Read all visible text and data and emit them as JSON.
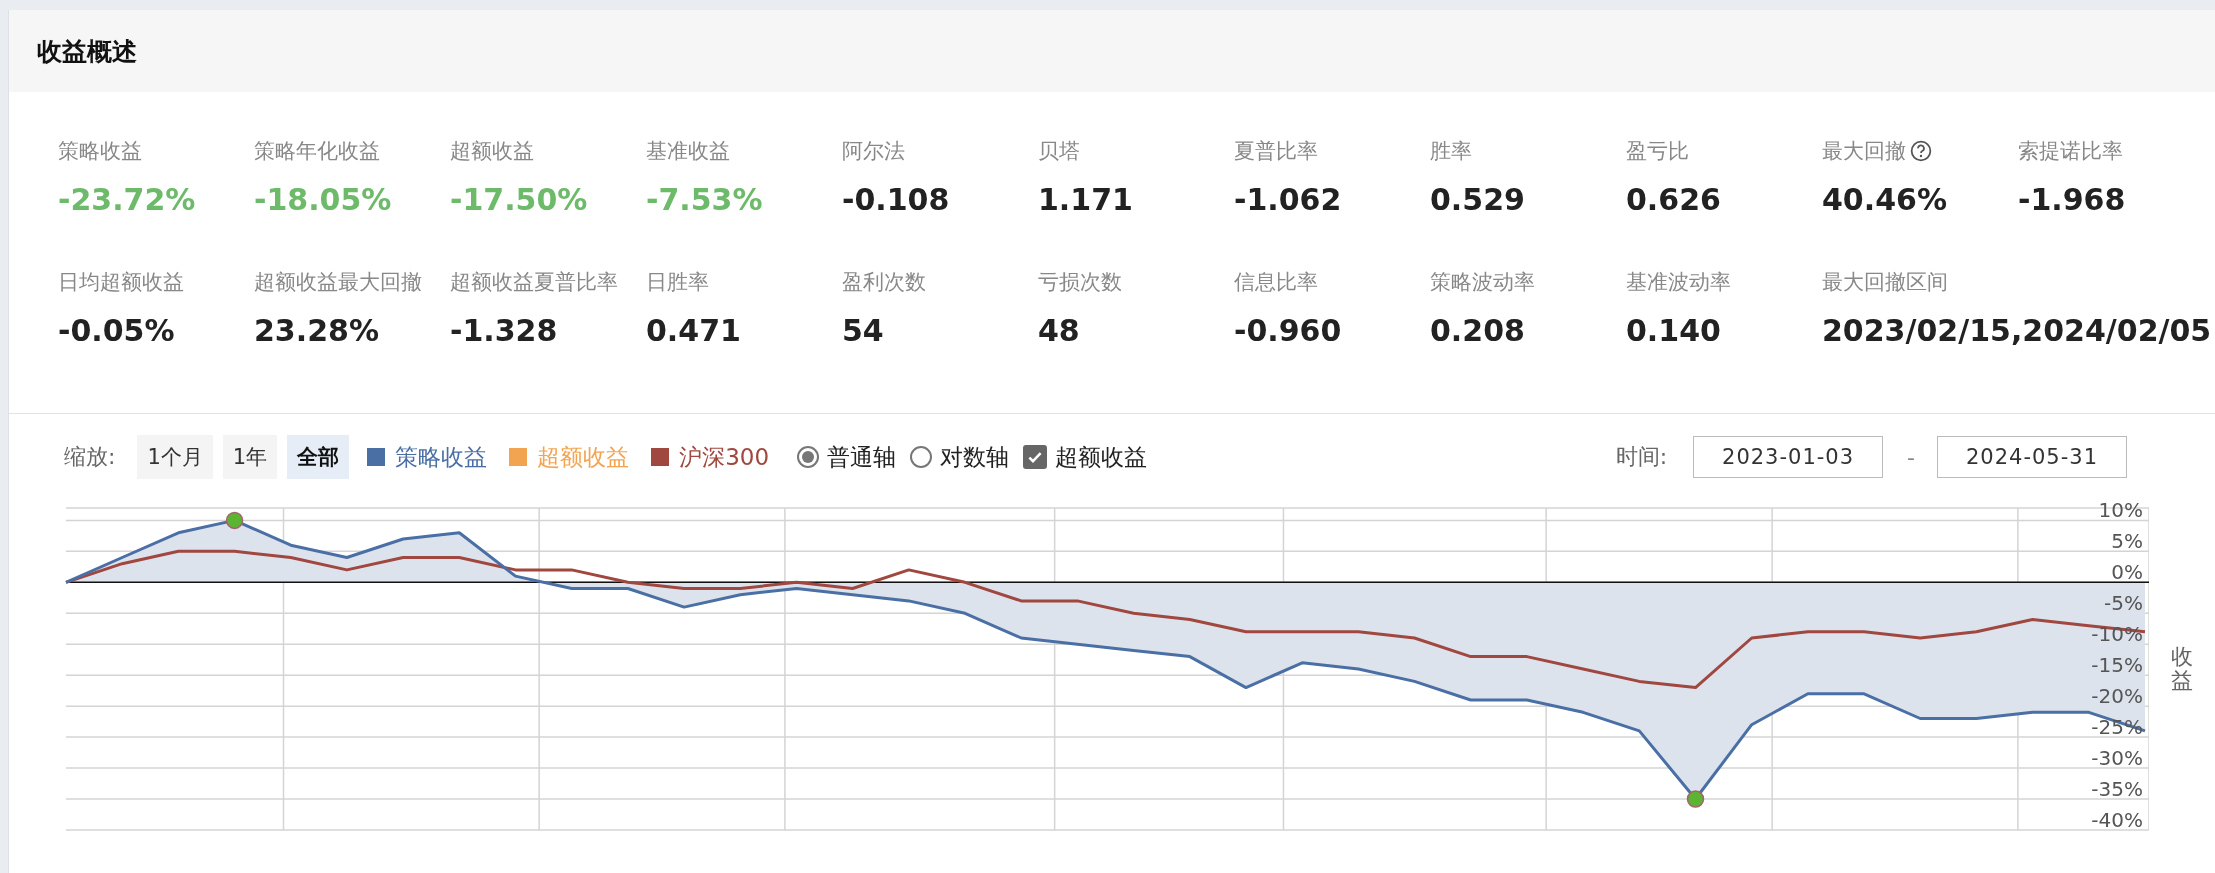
{
  "panel": {
    "title": "收益概述"
  },
  "metrics": [
    [
      {
        "label": "策略收益",
        "value": "-23.72%",
        "color": "#6dba6a",
        "has_help": false
      },
      {
        "label": "策略年化收益",
        "value": "-18.05%",
        "color": "#6dba6a",
        "has_help": false
      },
      {
        "label": "超额收益",
        "value": "-17.50%",
        "color": "#6dba6a",
        "has_help": false
      },
      {
        "label": "基准收益",
        "value": "-7.53%",
        "color": "#6dba6a",
        "has_help": false
      },
      {
        "label": "阿尔法",
        "value": "-0.108",
        "has_help": false
      },
      {
        "label": "贝塔",
        "value": "1.171",
        "has_help": false
      },
      {
        "label": "夏普比率",
        "value": "-1.062",
        "has_help": false
      },
      {
        "label": "胜率",
        "value": "0.529",
        "has_help": false
      },
      {
        "label": "盈亏比",
        "value": "0.626",
        "has_help": false
      },
      {
        "label": "最大回撤",
        "value": "40.46%",
        "has_help": true
      },
      {
        "label": "索提诺比率",
        "value": "-1.968",
        "has_help": false
      }
    ],
    [
      {
        "label": "日均超额收益",
        "value": "-0.05%",
        "has_help": false
      },
      {
        "label": "超额收益最大回撤",
        "value": "23.28%",
        "has_help": false
      },
      {
        "label": "超额收益夏普比率",
        "value": "-1.328",
        "has_help": false
      },
      {
        "label": "日胜率",
        "value": "0.471",
        "has_help": false
      },
      {
        "label": "盈利次数",
        "value": "54",
        "has_help": false
      },
      {
        "label": "亏损次数",
        "value": "48",
        "has_help": false
      },
      {
        "label": "信息比率",
        "value": "-0.960",
        "has_help": false
      },
      {
        "label": "策略波动率",
        "value": "0.208",
        "has_help": false
      },
      {
        "label": "基准波动率",
        "value": "0.140",
        "has_help": false
      },
      {
        "label": "最大回撤区间",
        "value": "2023/02/15,2024/02/05",
        "has_help": false
      }
    ]
  ],
  "controls": {
    "zoom_label": "缩放:",
    "zoom_buttons": [
      {
        "label": "1个月",
        "selected": false
      },
      {
        "label": "1年",
        "selected": false
      },
      {
        "label": "全部",
        "selected": true
      }
    ],
    "legend": [
      {
        "label": "策略收益",
        "color": "#4a6fa5"
      },
      {
        "label": "超额收益",
        "color": "#f2a450"
      },
      {
        "label": "沪深300",
        "color": "#a0473f"
      }
    ],
    "axis_options": [
      {
        "label": "普通轴",
        "selected": true
      },
      {
        "label": "对数轴",
        "selected": false
      }
    ],
    "excess_toggle": {
      "label": "超额收益",
      "checked": true
    },
    "time_label": "时间:",
    "start_date": "2023-01-03",
    "separator": "-",
    "end_date": "2024-05-31"
  },
  "chart": {
    "chart_data": {
      "type": "line",
      "grid": true,
      "ylabel": "收益",
      "ylim": [
        -40,
        12
      ],
      "yticks": [
        {
          "value": 10,
          "label": "10%"
        },
        {
          "value": 5,
          "label": "5%"
        },
        {
          "value": 0,
          "label": "0%"
        },
        {
          "value": -5,
          "label": "-5%"
        },
        {
          "value": -10,
          "label": "-10%"
        },
        {
          "value": -15,
          "label": "-15%"
        },
        {
          "value": -20,
          "label": "-20%"
        },
        {
          "value": -25,
          "label": "-25%"
        },
        {
          "value": -30,
          "label": "-30%"
        },
        {
          "value": -35,
          "label": "-35%"
        },
        {
          "value": -40,
          "label": "-40%"
        }
      ],
      "series": [
        {
          "color": "#4a6fa5",
          "values": [
            0,
            4,
            8,
            10,
            6,
            4,
            7,
            8,
            1,
            -1,
            -1,
            -4,
            -2,
            -1,
            -2,
            -3,
            -5,
            -9,
            -10,
            -11,
            -12,
            -17,
            -13,
            -14,
            -16,
            -19,
            -19,
            -21,
            -24,
            -35,
            -23,
            -18,
            -18,
            -22,
            -22,
            -21,
            -21,
            -24
          ]
        },
        {
          "color": "#a0473f",
          "values": [
            0,
            3,
            5,
            5,
            4,
            2,
            4,
            4,
            2,
            2,
            0,
            -1,
            -1,
            0,
            -1,
            2,
            0,
            -3,
            -3,
            -5,
            -6,
            -8,
            -8,
            -8,
            -9,
            -12,
            -12,
            -14,
            -16,
            -17,
            -9,
            -8,
            -8,
            -9,
            -8,
            -6,
            -7,
            -8
          ]
        }
      ]
    }
  }
}
